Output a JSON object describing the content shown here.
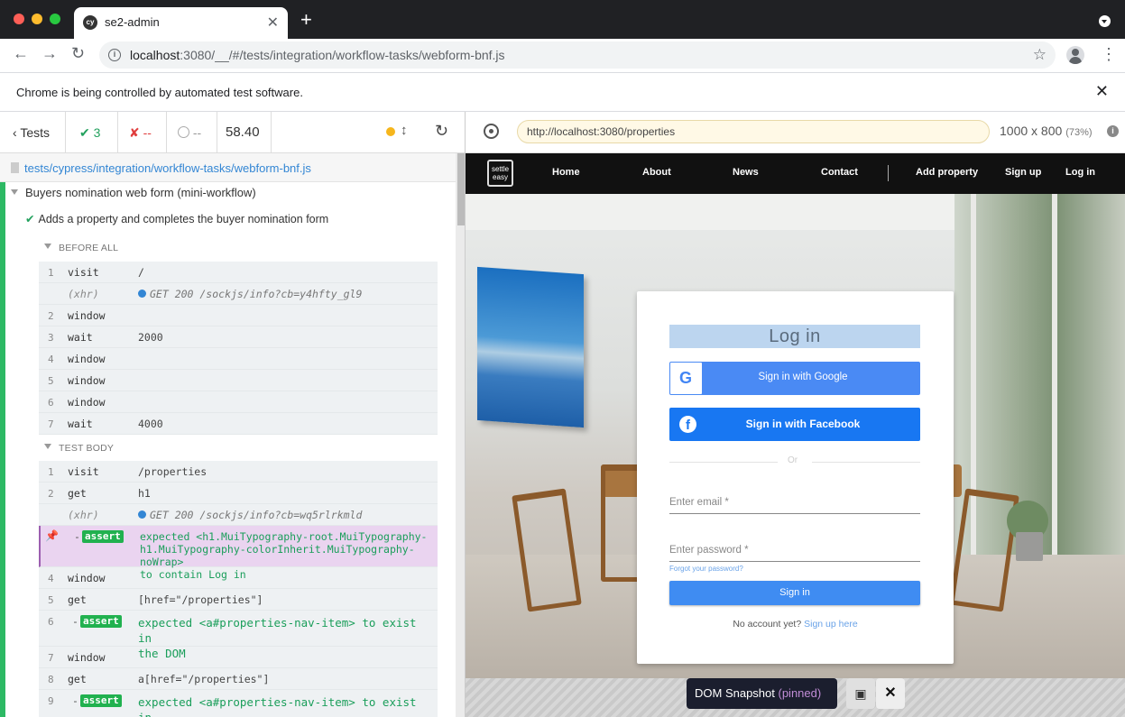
{
  "browser": {
    "tab_title": "se2-admin",
    "favicon_text": "cy",
    "url_host": "localhost",
    "url_rest": ":3080/__/#/tests/integration/workflow-tasks/webform-bnf.js",
    "infobar_text": "Chrome is being controlled by automated test software."
  },
  "reporter": {
    "tests_label": "Tests",
    "passed": "3",
    "failed": "--",
    "pending": "--",
    "duration": "58.40",
    "spec_path": "tests/cypress/integration/workflow-tasks/webform-bnf.js",
    "suite_title": "Buyers nomination web form (mini-workflow)",
    "test_title": "Adds a property and completes the buyer nomination form",
    "before_all_title": "BEFORE ALL",
    "test_body_title": "TEST BODY",
    "before_all": [
      {
        "num": "1",
        "name": "visit",
        "msg": "/"
      },
      {
        "num": "",
        "name": "(xhr)",
        "msg": "GET 200 /sockjs/info?cb=y4hfty_gl9"
      },
      {
        "num": "2",
        "name": "window",
        "msg": ""
      },
      {
        "num": "3",
        "name": "wait",
        "msg": "2000"
      },
      {
        "num": "4",
        "name": "window",
        "msg": ""
      },
      {
        "num": "5",
        "name": "window",
        "msg": ""
      },
      {
        "num": "6",
        "name": "window",
        "msg": ""
      },
      {
        "num": "7",
        "name": "wait",
        "msg": "4000"
      }
    ],
    "test_body": [
      {
        "num": "1",
        "name": "visit",
        "msg": "/properties"
      },
      {
        "num": "2",
        "name": "get",
        "msg": "h1"
      },
      {
        "num": "",
        "name": "(xhr)",
        "msg": "GET 200 /sockjs/info?cb=wq5rlrkmld"
      },
      {
        "num": "",
        "name": "assert",
        "msg": "expected <h1.MuiTypography-root.MuiTypography-\nh1.MuiTypography-colorInherit.MuiTypography-noWrap>\nto contain Log in"
      },
      {
        "num": "4",
        "name": "window",
        "msg": ""
      },
      {
        "num": "5",
        "name": "get",
        "msg": "[href=\"/properties\"]"
      },
      {
        "num": "6",
        "name": "assert",
        "msg": "expected <a#properties-nav-item> to exist in\nthe DOM"
      },
      {
        "num": "7",
        "name": "window",
        "msg": ""
      },
      {
        "num": "8",
        "name": "get",
        "msg": "a[href=\"/properties\"]"
      },
      {
        "num": "9",
        "name": "assert",
        "msg": "expected <a#properties-nav-item> to exist in\nthe DOM"
      }
    ],
    "assert_dash": "-"
  },
  "aut": {
    "url": "http://localhost:3080/properties",
    "size": "1000 x 800",
    "scale": "(73%)",
    "nav": [
      "Home",
      "About",
      "News",
      "Contact",
      "Add property",
      "Sign up",
      "Log in"
    ],
    "logo_text": "settle easy",
    "login": {
      "title": "Log in",
      "google": "Sign in with Google",
      "facebook": "Sign in with Facebook",
      "or": "Or",
      "email_ph": "Enter email *",
      "password_ph": "Enter password *",
      "forgot": "Forgot your password?",
      "signin": "Sign in",
      "no_account": "No account yet?",
      "signup_link": "Sign up here"
    },
    "snapshot_label": "DOM Snapshot",
    "snapshot_state": "(pinned)"
  }
}
